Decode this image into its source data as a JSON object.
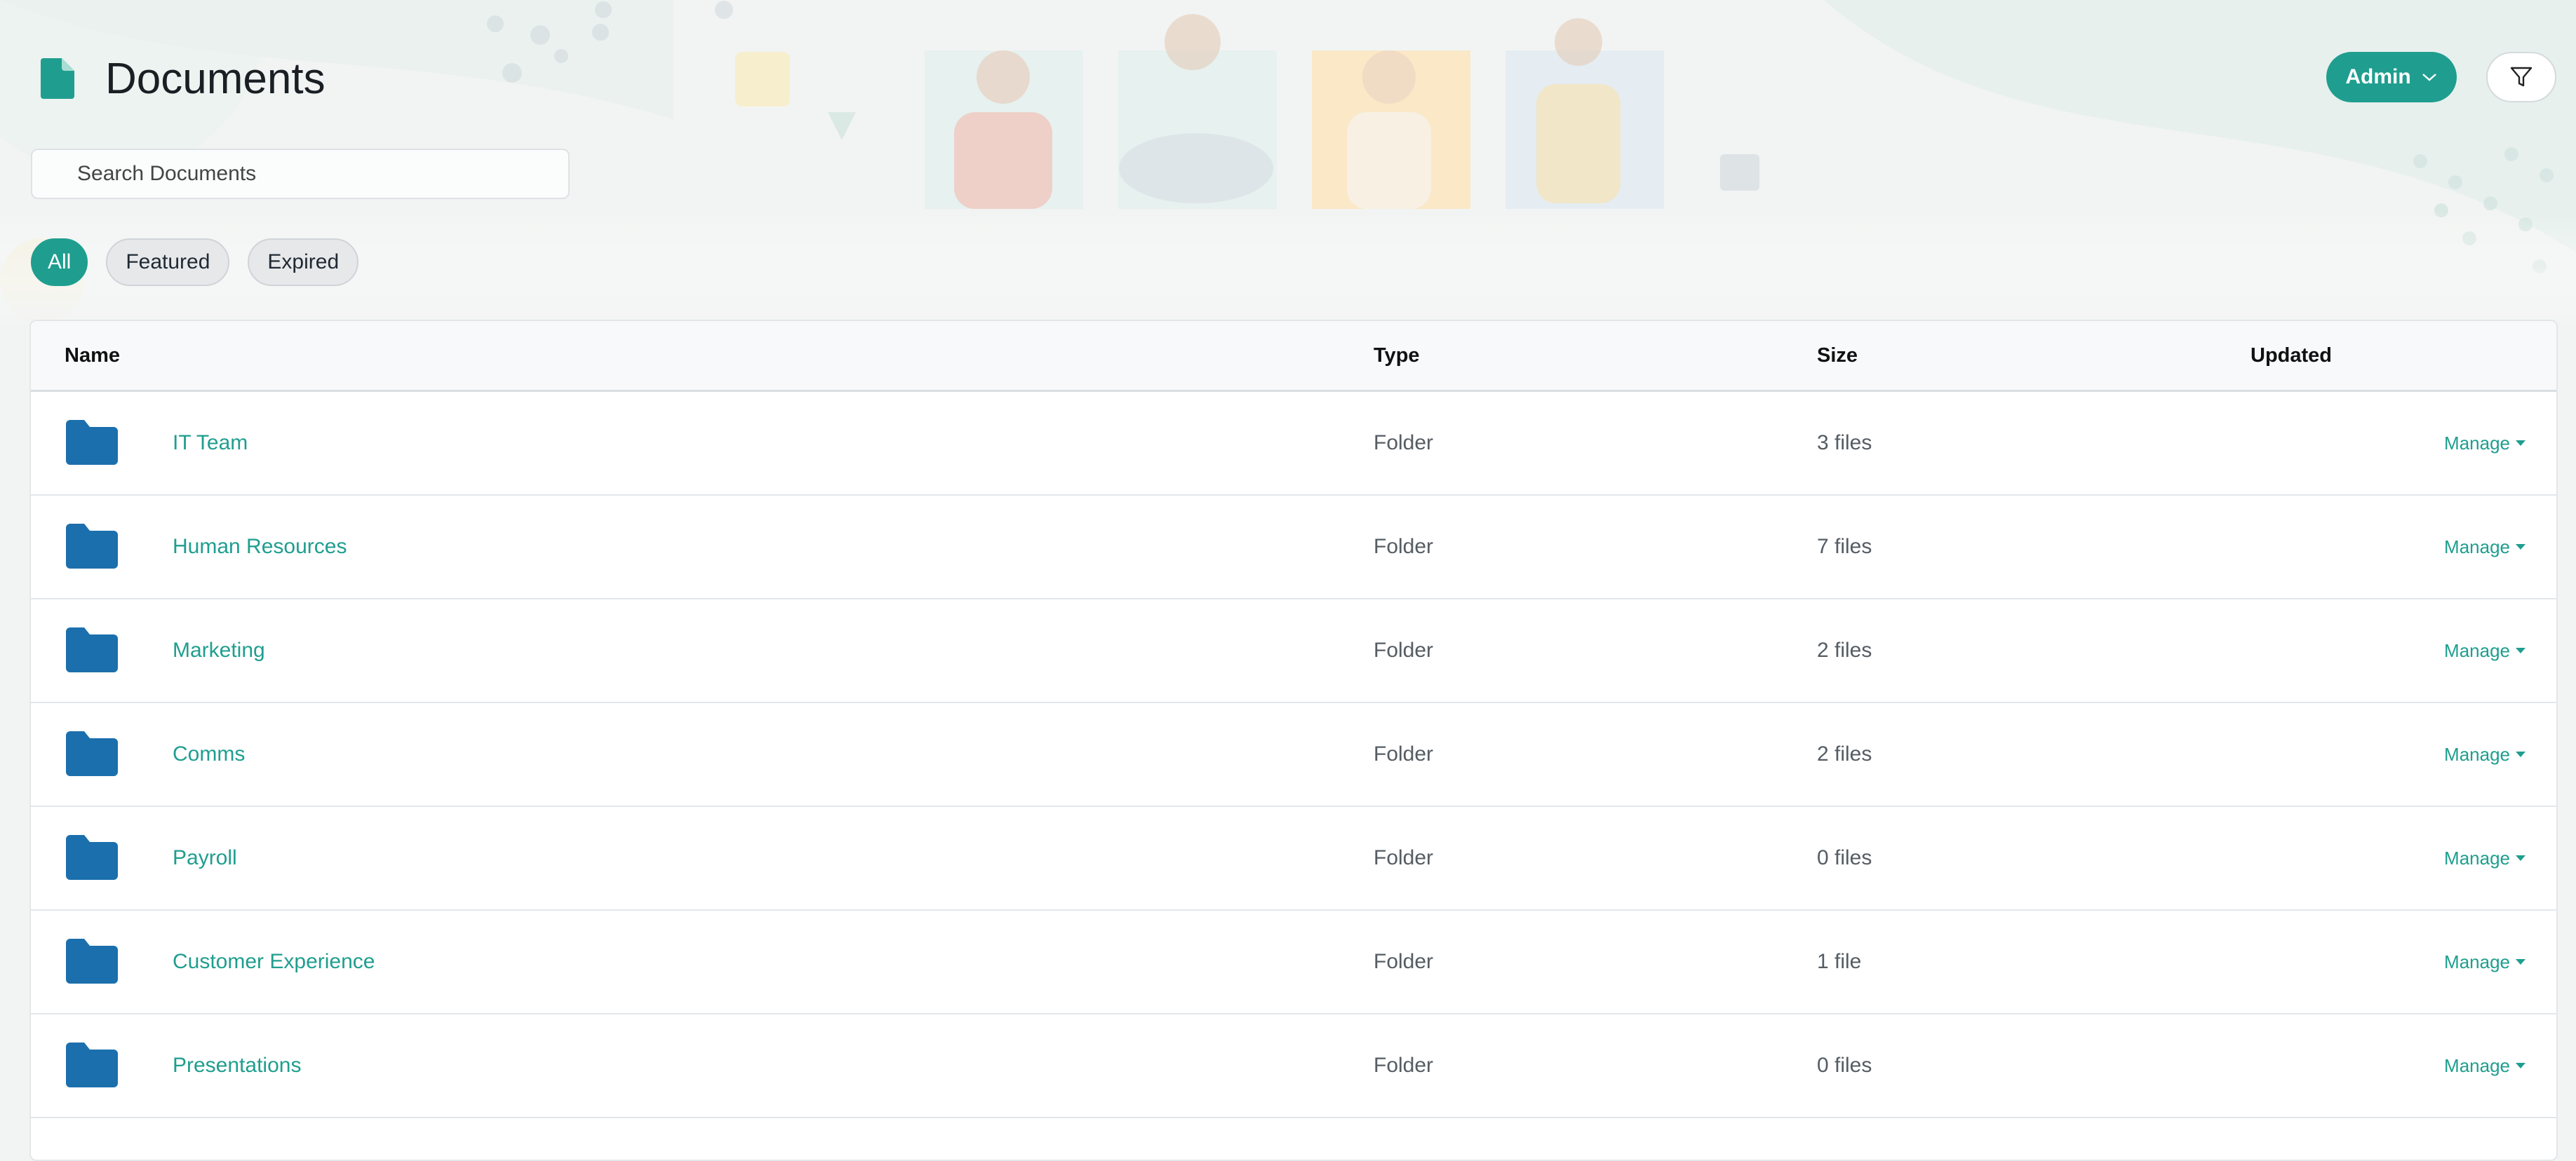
{
  "header": {
    "title": "Documents",
    "admin_label": "Admin"
  },
  "search": {
    "placeholder": "Search Documents",
    "value": ""
  },
  "filters": [
    {
      "label": "All",
      "active": true
    },
    {
      "label": "Featured",
      "active": false
    },
    {
      "label": "Expired",
      "active": false
    }
  ],
  "table": {
    "columns": {
      "name": "Name",
      "type": "Type",
      "size": "Size",
      "updated": "Updated"
    },
    "manage_label": "Manage",
    "rows": [
      {
        "name": "IT Team",
        "type": "Folder",
        "size": "3 files"
      },
      {
        "name": "Human Resources",
        "type": "Folder",
        "size": "7 files"
      },
      {
        "name": "Marketing",
        "type": "Folder",
        "size": "2 files"
      },
      {
        "name": "Comms",
        "type": "Folder",
        "size": "2 files"
      },
      {
        "name": "Payroll",
        "type": "Folder",
        "size": "0 files"
      },
      {
        "name": "Customer Experience",
        "type": "Folder",
        "size": "1 file"
      },
      {
        "name": "Presentations",
        "type": "Folder",
        "size": "0 files"
      }
    ]
  },
  "colors": {
    "accent": "#1f9e8f",
    "folder": "#1b6fad"
  },
  "icons": {
    "title": "document-icon",
    "admin_caret": "chevron-down-icon",
    "filter": "funnel-icon",
    "row": "folder-icon",
    "manage_caret": "caret-down-icon"
  }
}
